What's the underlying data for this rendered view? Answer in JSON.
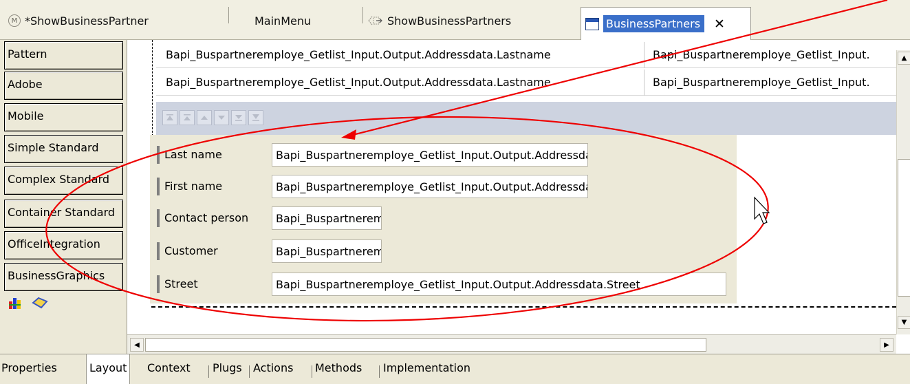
{
  "tabs": [
    {
      "label": "*ShowBusinessPartner",
      "icon": "model-icon",
      "active": false
    },
    {
      "label": "MainMenu",
      "icon": "",
      "active": false
    },
    {
      "label": "ShowBusinessPartners",
      "icon": "view-icon",
      "active": false
    },
    {
      "label": "BusinessPartners",
      "icon": "window-icon",
      "active": true,
      "close": "✕"
    }
  ],
  "palette": {
    "items": [
      "Pattern",
      "Adobe",
      "Mobile",
      "Simple Standard",
      "Complex Standard",
      "Container Standard",
      "OfficeIntegration",
      "BusinessGraphics"
    ]
  },
  "table": {
    "rows": [
      [
        "Bapi_Buspartneremploye_Getlist_Input.Output.Addressdata.Lastname",
        "Bapi_Buspartneremploye_Getlist_Input."
      ],
      [
        "Bapi_Buspartneremploye_Getlist_Input.Output.Addressdata.Lastname",
        "Bapi_Buspartneremploye_Getlist_Input."
      ]
    ]
  },
  "nav_buttons": [
    "first",
    "page-up",
    "up",
    "down",
    "page-down",
    "last"
  ],
  "form": {
    "fields": [
      {
        "label": "Last name",
        "value": "Bapi_Buspartneremploye_Getlist_Input.Output.Addressdata.Lastname"
      },
      {
        "label": "First name",
        "value": "Bapi_Buspartneremploye_Getlist_Input.Output.Addressdata.Firstname"
      },
      {
        "label": "Contact person",
        "value": "Bapi_Buspartneremploye_Getlist_Input.Output.Addressdata.Contact_person"
      },
      {
        "label": "Customer",
        "value": "Bapi_Buspartneremploye_Getlist_Input.Output.Addressdata.Customer"
      },
      {
        "label": "Street",
        "value": "Bapi_Buspartneremploye_Getlist_Input.Output.Addressdata.Street"
      }
    ]
  },
  "bottom_tabs": [
    "Properties",
    "Layout",
    "Context",
    "Plugs",
    "Actions",
    "Methods",
    "Implementation"
  ],
  "bottom_active": "Layout",
  "colors": {
    "annotation": "#ee0000",
    "active_tab": "#3a6fc9",
    "nav_bar": "#cdd3e0",
    "form_bg": "#ece9d8"
  }
}
